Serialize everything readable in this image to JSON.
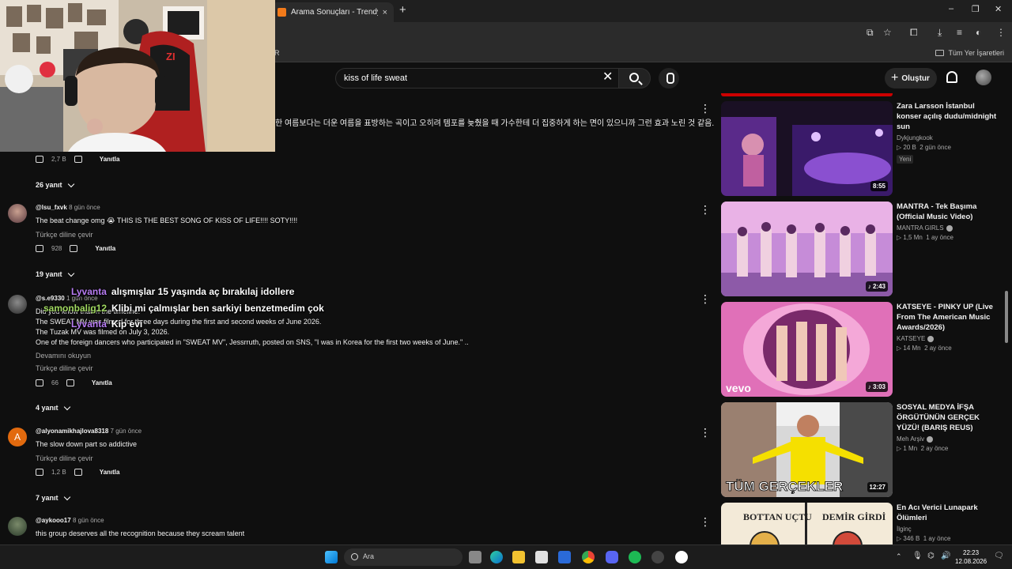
{
  "browser": {
    "tab_title": "Arama Sonuçları - Trendyol",
    "tab_close": "×",
    "new_tab": "+",
    "window_controls": [
      "–",
      "❐",
      "✕"
    ],
    "bookmark_left": "R",
    "bookmarks_all": "Tüm Yer İşaretleri"
  },
  "masthead": {
    "search_value": "kiss of life sweat",
    "clear": "✕",
    "create_label": "Oluştur",
    "create_plus": "+"
  },
  "comments": {
    "top": {
      "korean_text": "한 여름보다는 더운 여름을 표방하는 곡이고 오히려 템포를 늦췄을 때 가수한테 더 집중하게 하는 면이 있으니까 그런 효과 노린 것 같음.",
      "likes": "2,7 B",
      "reply": "Yanıtla",
      "replies": "26 yanıt"
    },
    "items": [
      {
        "user": "@lsu_fxvk",
        "time": "8 gün önce",
        "text": "The beat change omg 😭 THIS IS THE BEST SONG OF KISS OF LIFE!!!! SOTY!!!!",
        "translate": "Türkçe diline çevir",
        "likes": "928",
        "reply": "Yanıtla",
        "replies": "19 yanıt"
      },
      {
        "user": "@s.e9330",
        "time": "1 gün önce",
        "line1": "Did you know that in the timeline:",
        "line2": "The SWEAT MV was filmed for three days during the first and second weeks of June 2026.",
        "line3": "The Tuzak  MV was filmed on July 3, 2026.",
        "line4": "One of the foreign dancers who participated in \"SWEAT MV\", Jessrruth, posted on SNS, \"I was in Korea for the first two weeks of June.\" ..",
        "more": "Devamını okuyun",
        "translate": "Türkçe diline çevir",
        "likes": "66",
        "reply": "Yanıtla",
        "replies": "4 yanıt"
      },
      {
        "user": "@alyonamikhajlova8318",
        "time": "7 gün önce",
        "avatar_letter": "A",
        "text": "The slow down part so addictive",
        "translate": "Türkçe diline çevir",
        "likes": "1,2 B",
        "reply": "Yanıtla",
        "replies": "7 yanıt"
      },
      {
        "user": "@aykooo17",
        "time": "8 gün önce",
        "text": "this group deserves all the recognition because they scream talent"
      }
    ]
  },
  "chat_overlay": [
    {
      "user": "Lyvanta",
      "message": "alışmışlar 15 yaşında aç bırakılaj idollere"
    },
    {
      "user": "samonbalig12",
      "message": "Klibi mi çalmışlar ben sarkiyi benzetmedim çok"
    },
    {
      "user": "Lyvanta",
      "message": "Kip evi"
    }
  ],
  "sidebar": [
    {
      "title": "Zara Larsson İstanbul konser açılış dudu/midnight sun",
      "channel": "Dykjungkook",
      "verified": false,
      "views": "20 B",
      "time": "2 gün önce",
      "badge": "Yeni",
      "duration": "8:55",
      "colors": [
        "#2a1a3a",
        "#6a3fb0",
        "#c070e0"
      ]
    },
    {
      "title": "MANTRA - Tek Başıma (Official Music Video)",
      "channel": "MANTRA GIRLS",
      "verified": true,
      "views": "1,5 Mn",
      "time": "1 ay önce",
      "duration": "2:43",
      "colors": [
        "#b070c8",
        "#e8a0d8",
        "#7a4aa8"
      ]
    },
    {
      "title": "KATSEYE - PINKY UP (Live From The American Music Awards/2026)",
      "channel": "KATSEYE",
      "verified": true,
      "views": "14 Mn",
      "time": "2 ay önce",
      "duration": "3:03",
      "overlay": "vevo",
      "colors": [
        "#c83a8c",
        "#f08ac8",
        "#6a1a50"
      ]
    },
    {
      "title": "SOSYAL MEDYA İFŞA ÖRGÜTÜNÜN GERÇEK YÜZÜ! (BARIŞ REUS)",
      "channel": "Meh Arşiv",
      "verified": true,
      "views": "1 Mn",
      "time": "2 ay önce",
      "duration": "12:27",
      "overlay": "TÜM GERÇEKLER",
      "colors": [
        "#e0e0e0",
        "#f5e000",
        "#8a8a8a"
      ]
    },
    {
      "title": "En Acı Verici Lunapark Ölümleri",
      "channel": "İlginç",
      "verified": false,
      "views": "346 B",
      "time": "1 ay önce",
      "overlay_left": "BOTTAN UÇTU",
      "overlay_right": "DEMİR GİRDİ",
      "colors": [
        "#f3ead8",
        "#e4b04a",
        "#d24a3a"
      ]
    }
  ],
  "taskbar": {
    "search_placeholder": "Ara",
    "time": "22:23",
    "date": "12.08.2026"
  },
  "webcam": {
    "headset_label": "ZI"
  }
}
